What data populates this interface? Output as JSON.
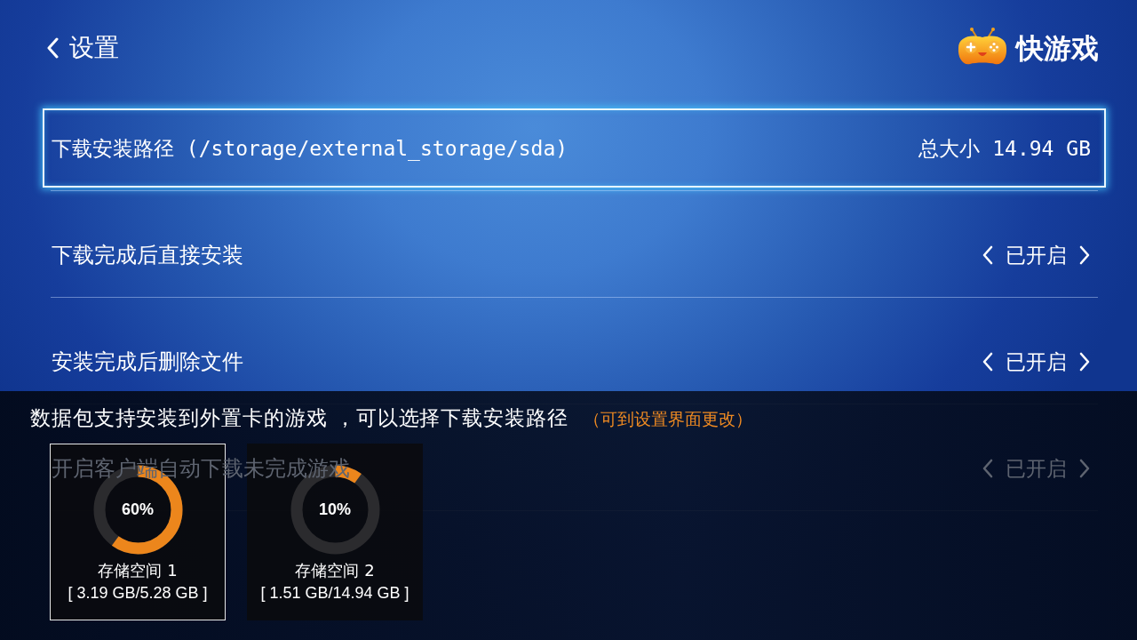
{
  "header": {
    "title": "设置"
  },
  "brand": {
    "name": "快游戏"
  },
  "settings": [
    {
      "kind": "path",
      "label": "下载安装路径 (/storage/external_storage/sda)",
      "info": "总大小 14.94 GB",
      "selected": true
    },
    {
      "kind": "toggle",
      "label": "下载完成后直接安装",
      "value": "已开启",
      "selected": false
    },
    {
      "kind": "toggle",
      "label": "安装完成后删除文件",
      "value": "已开启",
      "selected": false
    },
    {
      "kind": "toggle",
      "label": "开启客户端自动下载未完成游戏",
      "value": "已开启",
      "selected": false
    }
  ],
  "storage_popup": {
    "hint": "数据包支持安装到外置卡的游戏 ，可以选择下载安装路径",
    "note": "（可到设置界面更改）",
    "volumes": [
      {
        "name": "存储空间 1",
        "usage": "[ 3.19 GB/5.28 GB ]",
        "percent": "60%",
        "level": 0.6,
        "selected": true
      },
      {
        "name": "存储空间 2",
        "usage": "[ 1.51 GB/14.94 GB ]",
        "percent": "10%",
        "level": 0.1,
        "selected": false
      }
    ]
  }
}
